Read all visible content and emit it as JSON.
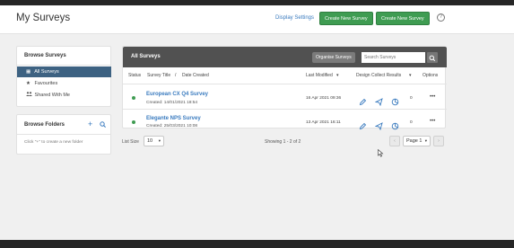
{
  "header": {
    "title": "My Surveys",
    "display_settings": "Display Settings",
    "new_survey_1": "Create New Survey",
    "new_survey_2": "Create New Survey",
    "help_glyph": "?"
  },
  "browse_surveys": {
    "title": "Browse Surveys",
    "items": [
      {
        "label": "All Surveys",
        "icon": "grid-icon",
        "glyph": "▦"
      },
      {
        "label": "Favourites",
        "icon": "star-icon",
        "glyph": "★"
      },
      {
        "label": "Shared With Me",
        "icon": "people-icon",
        "glyph": "👥"
      }
    ]
  },
  "browse_folders": {
    "title": "Browse Folders",
    "add_glyph": "+",
    "hint": "Click \"+\" to create a new folder"
  },
  "table": {
    "title": "All Surveys",
    "organise_label": "Organise Surveys",
    "search_placeholder": "Search Surveys",
    "columns": {
      "status": "Status",
      "title": "Survey Title",
      "sep": "/",
      "date": "Date Created",
      "modified": "Last Modified",
      "sort_glyph": "▾",
      "dcr": "Design Collect Results",
      "dcr_glyph": "▾",
      "options": "Options"
    },
    "rows": [
      {
        "title": "European CX Q4 Survey",
        "created": "Created: 14/01/2021 18:54",
        "modified": "16 Apr 2021 09:36",
        "results": "0",
        "options": "•••"
      },
      {
        "title": "Elegante NPS Survey",
        "created": "Created: 25/03/2021 10:08",
        "modified": "13 Apr 2021 16:11",
        "results": "0",
        "options": "•••"
      }
    ],
    "footer": {
      "list_size_label": "List Size",
      "list_size": "10",
      "showing": "Showing 1 - 2 of 2",
      "page": "Page 1",
      "prev": "‹",
      "next": "›"
    }
  },
  "colors": {
    "accent_green": "#3f9c52",
    "link_blue": "#3a7bbf",
    "active_nav": "#3d6282",
    "table_header": "#515151"
  }
}
